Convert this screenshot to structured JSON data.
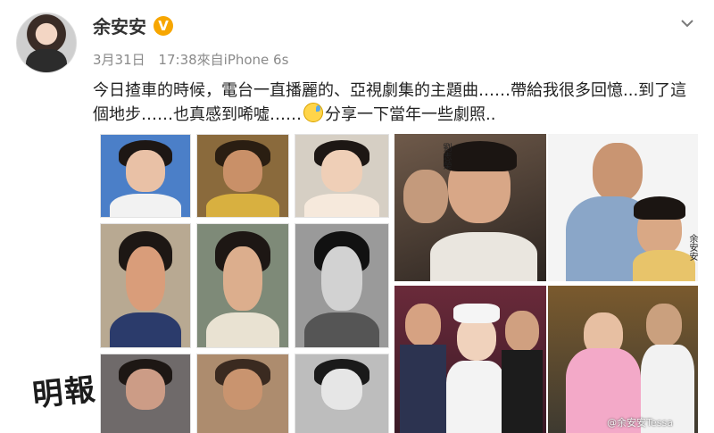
{
  "user": {
    "name": "余安安",
    "verified_mark": "V"
  },
  "meta": {
    "date": "3月31日",
    "time_source": "17:38來自iPhone 6s"
  },
  "post": {
    "text_part1": "今日揸車的時候，電台一直播麗的、亞視劇集的主題曲……帶給我很多回憶...到了這個地步……也真感到唏噓……",
    "text_part2": "分享一下當年一些劇照.."
  },
  "photo_captions": {
    "man": "劉志榮",
    "woman": "余安安"
  },
  "watermark": "明報",
  "source_mark": "@余安安Tessa",
  "colors": {
    "accent_verified": "#f7a600",
    "text_meta": "#8a8a8a"
  },
  "icons": {
    "verified": "verified-badge-icon",
    "menu": "chevron-down-icon",
    "emoji": "sweat-emoji-icon"
  }
}
